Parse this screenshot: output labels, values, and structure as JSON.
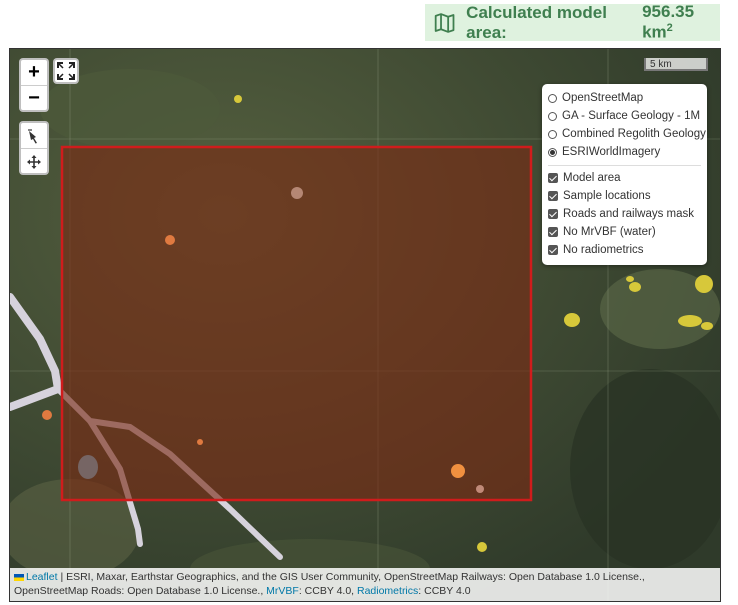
{
  "model_area": {
    "label": "Calculated model area:",
    "value": "956.35 km",
    "unit_superscript": "2",
    "icon": "map-icon"
  },
  "map": {
    "scale_label": "5 km",
    "controls": {
      "zoom_in": "+",
      "zoom_out": "−",
      "icons": [
        "fullscreen-icon",
        "draw-icon",
        "move-icon"
      ]
    },
    "base_layers": [
      {
        "label": "OpenStreetMap",
        "selected": false
      },
      {
        "label": "GA - Surface Geology - 1M",
        "selected": false
      },
      {
        "label": "Combined Regolith Geology",
        "selected": false
      },
      {
        "label": "ESRIWorldImagery",
        "selected": true
      }
    ],
    "overlays": [
      {
        "label": "Model area",
        "checked": true
      },
      {
        "label": "Sample locations",
        "checked": true
      },
      {
        "label": "Roads and railways mask",
        "checked": true
      },
      {
        "label": "No MrVBF (water)",
        "checked": true
      },
      {
        "label": "No radiometrics",
        "checked": true
      }
    ],
    "colors": {
      "model_area_border": "#d01c1c",
      "model_area_fill": "#7a2a14",
      "road_mask": "#d6d2dc",
      "water": "#6ec6e8",
      "radiometrics_gap": "#d7c83a"
    },
    "attribution": {
      "leaflet_link": "Leaflet",
      "part1": " | ESRI, Maxar, Earthstar Geographics, and the GIS User Community, OpenStreetMap Railways: Open Database 1.0 License., OpenStreetMap Roads: Open Database 1.0 License., ",
      "mrvbf_link": "MrVBF",
      "part2": ": CCBY 4.0, ",
      "radiometrics_link": "Radiometrics",
      "part3": ": CCBY 4.0"
    }
  }
}
